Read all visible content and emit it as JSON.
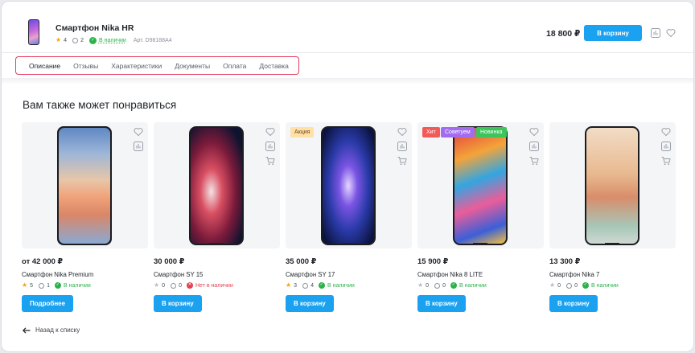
{
  "product": {
    "title": "Смартфон Nika HR",
    "rating": "4",
    "reviews": "2",
    "availability": "В наличии",
    "article": "Арт. D98188A4",
    "price": "18 800 ₽",
    "cart_button": "В корзину"
  },
  "tabs": [
    {
      "label": "Описание",
      "active": true
    },
    {
      "label": "Отзывы"
    },
    {
      "label": "Характеристики"
    },
    {
      "label": "Документы"
    },
    {
      "label": "Оплата"
    },
    {
      "label": "Доставка"
    }
  ],
  "section_title": "Вам также может понравиться",
  "cards": [
    {
      "price": "от 42 000 ₽",
      "name": "Смартфон Nika Premium",
      "rating": "5",
      "reviews": "1",
      "availability": "В наличии",
      "button": "Подробнее",
      "badges": []
    },
    {
      "price": "30 000 ₽",
      "name": "Смартфон SY 15",
      "rating": "0",
      "reviews": "0",
      "availability": "Нет в наличии",
      "button": "В корзину",
      "badges": []
    },
    {
      "price": "35 000 ₽",
      "name": "Смартфон SY 17",
      "rating": "3",
      "reviews": "4",
      "availability": "В наличии",
      "button": "В корзину",
      "badges": [
        "Акция"
      ]
    },
    {
      "price": "15 900 ₽",
      "name": "Смартфон Nika 8 LITE",
      "rating": "0",
      "reviews": "0",
      "availability": "В наличии",
      "button": "В корзину",
      "badges": [
        "Хит",
        "Советуем",
        "Новинка"
      ]
    },
    {
      "price": "13 300 ₽",
      "name": "Смартфон Nika 7",
      "rating": "0",
      "reviews": "0",
      "availability": "В наличии",
      "button": "В корзину",
      "badges": []
    }
  ],
  "back_link": "Назад к списку",
  "colors": {
    "accent": "#1aa1ef",
    "in_stock": "#2bb34a",
    "out_of_stock": "#e5414f",
    "tab_outline": "#e53e5e"
  }
}
